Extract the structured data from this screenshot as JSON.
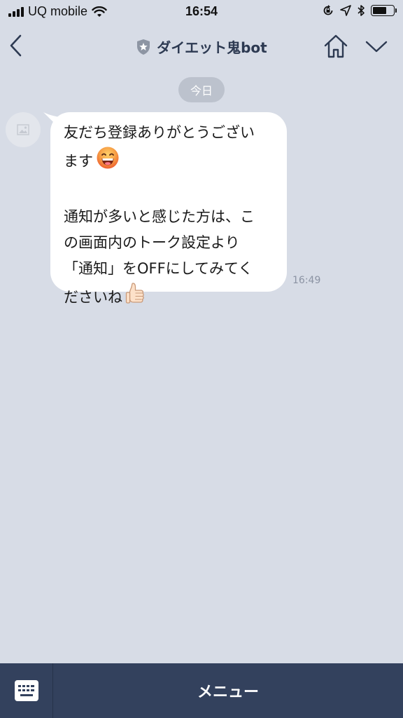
{
  "status_bar": {
    "carrier": "UQ mobile",
    "time": "16:54",
    "battery_level": 0.7
  },
  "header": {
    "title": "ダイエット鬼bot",
    "back_icon": "chevron-left-icon",
    "badge_icon": "shield-star-icon",
    "home_icon": "home-icon",
    "dropdown_icon": "chevron-down-icon"
  },
  "chat": {
    "date_label": "今日",
    "messages": [
      {
        "line1": "友だち登録ありがとうござい",
        "line2": "ます",
        "line3": "通知が多いと感じた方は、こ",
        "line4": "の画面内のトーク設定より",
        "line5": "「通知」をOFFにしてみてく",
        "line6": "ださいね",
        "emoji1": "grinning-face-emoji",
        "emoji2": "thumbs-up-emoji",
        "time": "16:49"
      }
    ]
  },
  "bottom_bar": {
    "menu_label": "メニュー",
    "keyboard_icon": "keyboard-icon"
  },
  "colors": {
    "background": "#d7dce6",
    "bubble": "#ffffff",
    "bottom_bar": "#33415d",
    "title_text": "#2d3a52"
  }
}
